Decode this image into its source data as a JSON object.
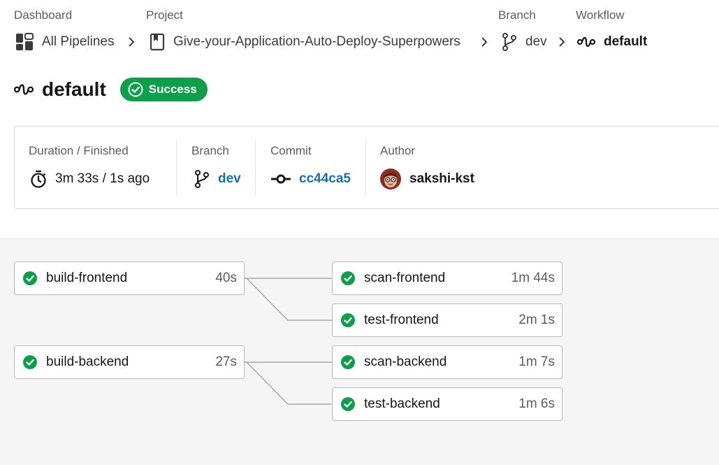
{
  "breadcrumb": {
    "headers": {
      "dashboard": "Dashboard",
      "project": "Project",
      "branch": "Branch",
      "workflow": "Workflow"
    },
    "items": {
      "pipelines": "All Pipelines",
      "project": "Give-your-Application-Auto-Deploy-Superpowers",
      "branch": "dev",
      "workflow": "default"
    }
  },
  "header": {
    "title": "default",
    "status": "Success"
  },
  "info": {
    "duration_label": "Duration / Finished",
    "duration_value": "3m 33s / 1s ago",
    "branch_label": "Branch",
    "branch_value": "dev",
    "commit_label": "Commit",
    "commit_value": "cc44ca5",
    "author_label": "Author",
    "author_value": "sakshi-kst"
  },
  "jobs": [
    {
      "name": "build-frontend",
      "duration": "40s",
      "status": "success"
    },
    {
      "name": "scan-frontend",
      "duration": "1m 44s",
      "status": "success"
    },
    {
      "name": "test-frontend",
      "duration": "2m 1s",
      "status": "success"
    },
    {
      "name": "build-backend",
      "duration": "27s",
      "status": "success"
    },
    {
      "name": "scan-backend",
      "duration": "1m 7s",
      "status": "success"
    },
    {
      "name": "test-backend",
      "duration": "1m 6s",
      "status": "success"
    }
  ],
  "colors": {
    "success": "#0e9f4b",
    "link": "#1b6fb3"
  },
  "icons": {
    "pipelines": "dashboard-grid-icon",
    "project": "bookmark-icon",
    "branch": "git-branch-icon",
    "workflow": "workflow-icon",
    "duration": "stopwatch-icon",
    "commit": "git-commit-icon",
    "status": "check-circle-icon"
  }
}
